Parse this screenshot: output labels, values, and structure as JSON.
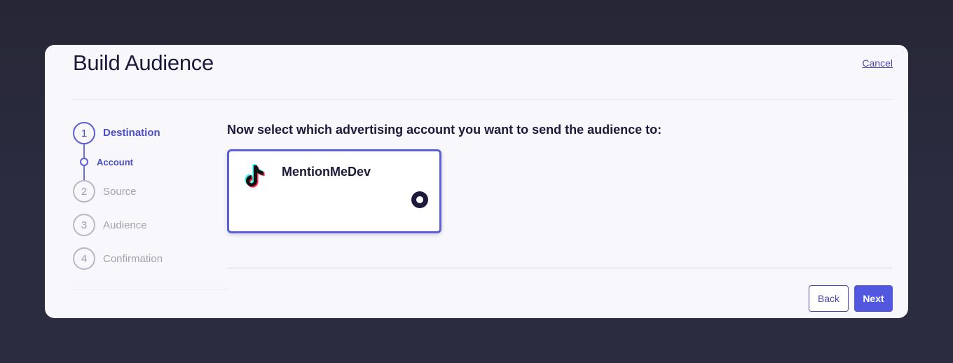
{
  "header": {
    "title": "Build Audience",
    "cancel_label": "Cancel"
  },
  "stepper": {
    "steps": [
      {
        "number": "1",
        "label": "Destination",
        "state": "active"
      },
      {
        "number": "2",
        "label": "Source",
        "state": "inactive"
      },
      {
        "number": "3",
        "label": "Audience",
        "state": "inactive"
      },
      {
        "number": "4",
        "label": "Confirmation",
        "state": "inactive"
      }
    ],
    "substep_label": "Account"
  },
  "main": {
    "prompt": "Now select which advertising account you want to send the audience to:",
    "accounts": [
      {
        "name": "MentionMeDev",
        "platform_icon": "tiktok-icon",
        "selected": true
      }
    ]
  },
  "footer": {
    "back_label": "Back",
    "next_label": "Next"
  },
  "colors": {
    "accent": "#5257e0",
    "text_dark": "#1c1a3b",
    "inactive": "#a3a3b0"
  }
}
